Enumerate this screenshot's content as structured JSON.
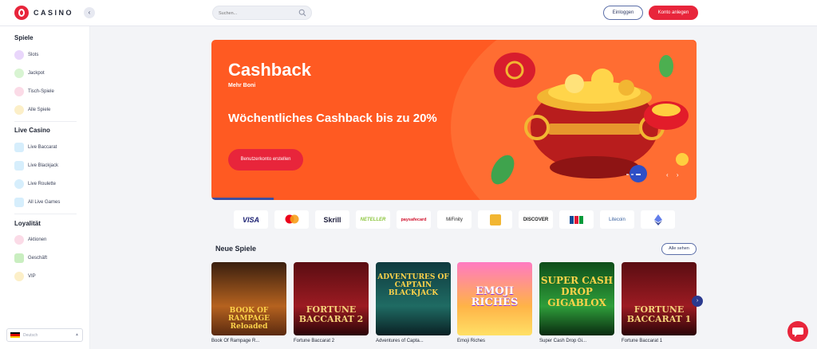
{
  "header": {
    "logo_text": "CASINO",
    "collapse_icon": "chevron-left-icon",
    "search_placeholder": "Suchen...",
    "login_label": "Einloggen",
    "register_label": "Konto anlegen"
  },
  "sidebar": {
    "sections": [
      {
        "title": "Spiele",
        "items": [
          {
            "label": "Slots",
            "icon": "slots-icon",
            "color": "#b46cf0"
          },
          {
            "label": "Jackpot",
            "icon": "jackpot-icon",
            "color": "#7dd96e"
          },
          {
            "label": "Tisch-Spiele",
            "icon": "table-games-icon",
            "color": "#f07aa5"
          },
          {
            "label": "Alle Spiele",
            "icon": "all-games-icon",
            "color": "#f7c948"
          }
        ]
      },
      {
        "title": "Live Casino",
        "items": [
          {
            "label": "Live Baccarat",
            "icon": "live-baccarat-icon",
            "color": "#6bc4f5"
          },
          {
            "label": "Live Blackjack",
            "icon": "live-blackjack-icon",
            "color": "#6bc4f5"
          },
          {
            "label": "Live Roulette",
            "icon": "live-roulette-icon",
            "color": "#6bc4f5"
          },
          {
            "label": "All Live Games",
            "icon": "all-live-games-icon",
            "color": "#6bc4f5"
          }
        ]
      },
      {
        "title": "Loyalität",
        "items": [
          {
            "label": "Aktionen",
            "icon": "promotions-icon",
            "color": "#f07aa5"
          },
          {
            "label": "Geschäft",
            "icon": "shop-icon",
            "color": "#7dd96e"
          },
          {
            "label": "VIP",
            "icon": "vip-icon",
            "color": "#f7c948"
          }
        ]
      }
    ],
    "language": "Deutsch"
  },
  "banner": {
    "title": "Cashback",
    "subtitle": "Mehr Boni",
    "headline": "Wöchentliches Cashback bis zu 20%",
    "cta_label": "Benutzerkonto erstellen",
    "arrows": "‹ ›"
  },
  "payments": [
    "VISA",
    "mastercard",
    "Skrill",
    "NETELLER",
    "paysafecard",
    "MiFinity",
    "bank",
    "DISCOVER",
    "JCB",
    "Litecoin",
    "Ethereum"
  ],
  "games_section": {
    "title": "Neue Spiele",
    "see_all_label": "Alle sehen",
    "games": [
      {
        "label": "Book Of Rampage R...",
        "art": "BOOK OF RAMPAGE Reloaded"
      },
      {
        "label": "Fortune Baccarat 2",
        "art": "FORTUNE BACCARAT 2"
      },
      {
        "label": "Adventures of Capta...",
        "art": "ADVENTURES OF CAPTAIN BLACKJACK"
      },
      {
        "label": "Emoji Riches",
        "art": "EMOJI RICHES"
      },
      {
        "label": "Super Cash Drop Gi...",
        "art": "SUPER CASH DROP GIGABLOX"
      },
      {
        "label": "Fortune Baccarat 1",
        "art": "FORTUNE BACCARAT 1"
      }
    ]
  }
}
